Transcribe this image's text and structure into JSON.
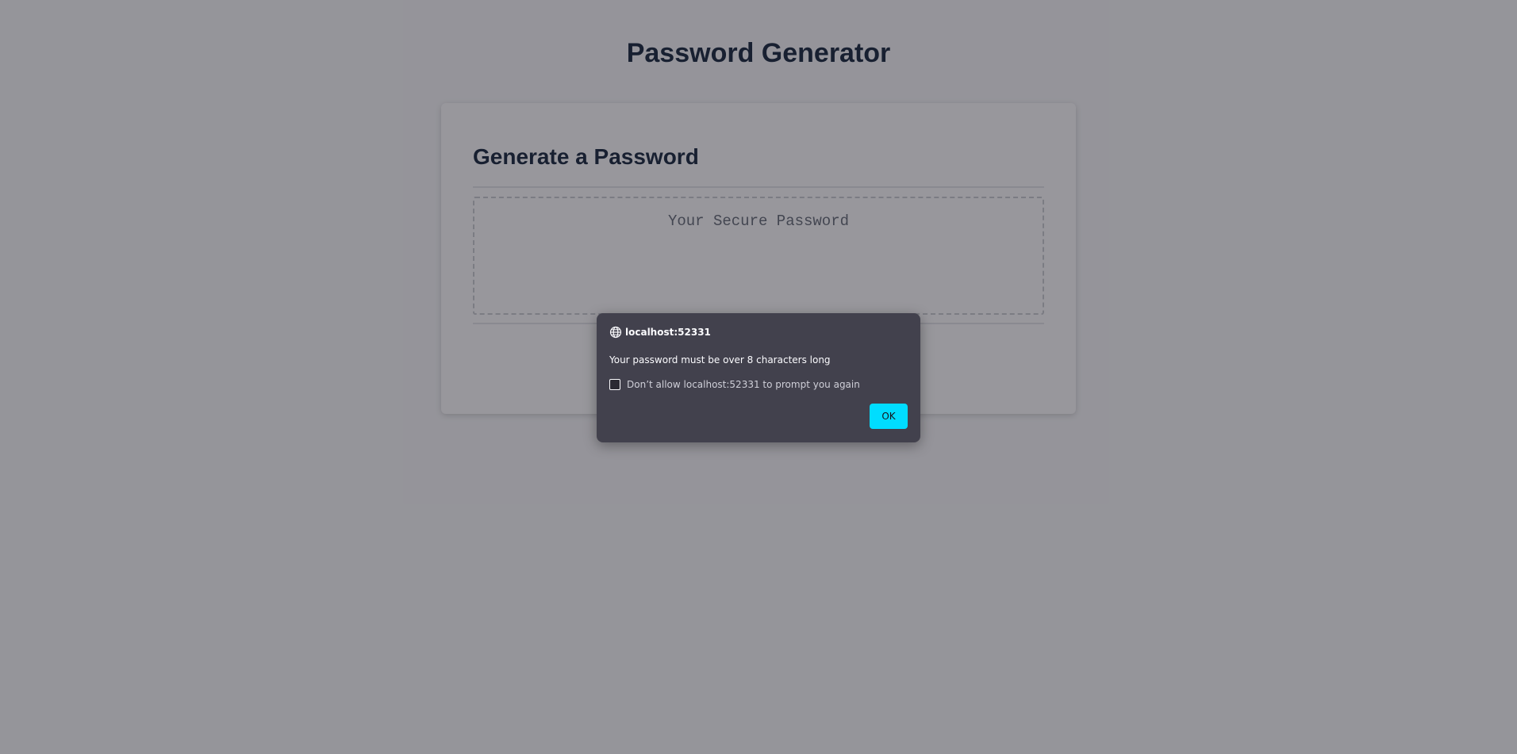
{
  "page": {
    "title": "Password Generator"
  },
  "card": {
    "title": "Generate a Password",
    "password_placeholder": "Your Secure Password"
  },
  "dialog": {
    "origin": "localhost:52331",
    "message": "Your password must be over 8 characters long",
    "checkbox_label": "Don’t allow localhost:52331 to prompt you again",
    "checkbox_checked": false,
    "ok_label": "OK",
    "globe_icon": "globe-icon"
  },
  "colors": {
    "heading_text": "#0b1b33",
    "dialog_background": "#42414d",
    "ok_button": "#00ddff"
  }
}
